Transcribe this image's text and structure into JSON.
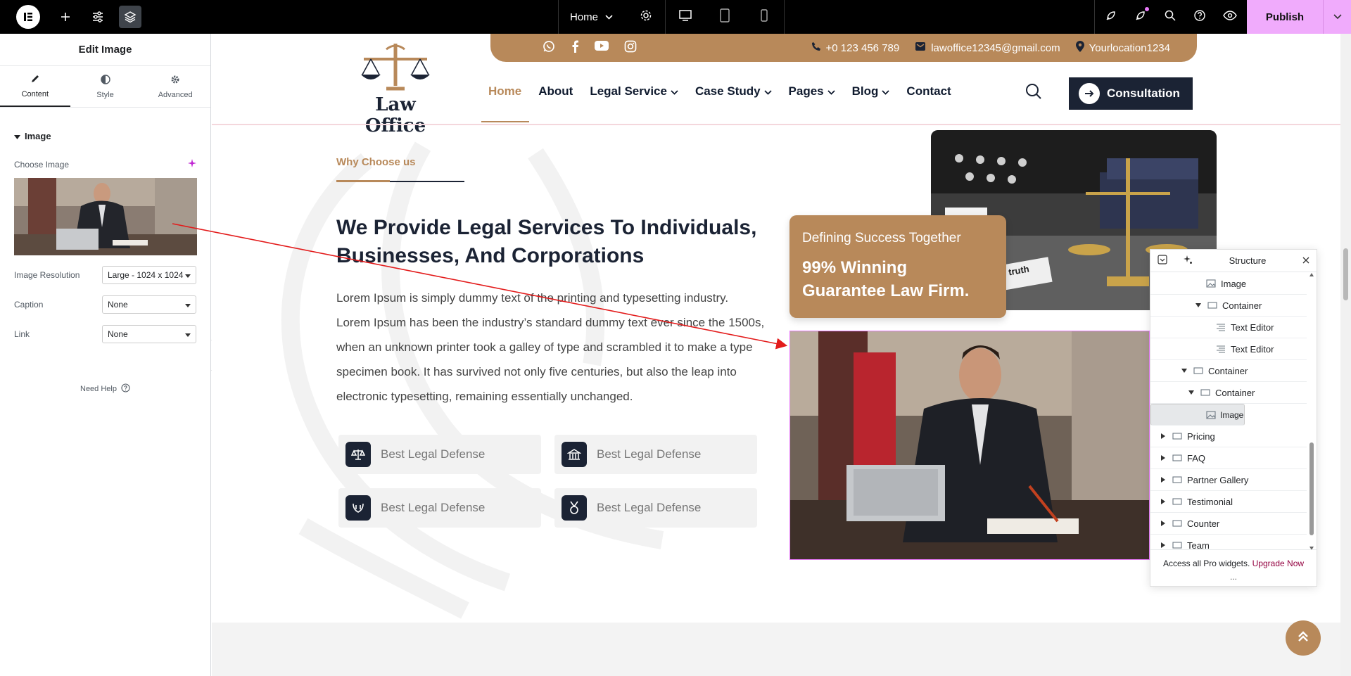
{
  "topbar": {
    "page_name": "Home",
    "publish_label": "Publish"
  },
  "panel": {
    "title": "Edit Image",
    "tabs": [
      {
        "label": "Content"
      },
      {
        "label": "Style"
      },
      {
        "label": "Advanced"
      }
    ],
    "section_title": "Image",
    "choose_image_label": "Choose Image",
    "controls": [
      {
        "label": "Image Resolution",
        "value": "Large - 1024 x 1024"
      },
      {
        "label": "Caption",
        "value": "None"
      },
      {
        "label": "Link",
        "value": "None"
      }
    ],
    "need_help": "Need Help"
  },
  "site": {
    "phone": "+0 123 456 789",
    "email": "lawoffice12345@gmail.com",
    "location": "Yourlocation1234",
    "logo_text": "Law Office",
    "nav": [
      "Home",
      "About",
      "Legal Service",
      "Case Study",
      "Pages",
      "Blog",
      "Contact"
    ],
    "consult_label": "Consultation",
    "eyebrow": "Why Choose us",
    "headline": "We Provide Legal Services To Individuals, Businesses, And Corporations",
    "paragraph": "Lorem Ipsum is simply dummy text of the printing and typesetting industry. Lorem Ipsum has been the industry’s standard dummy text ever since the 1500s, when an unknown printer took a galley of type and scrambled it to make a type specimen book. It has survived not only five centuries, but also the leap into electronic typesetting, remaining essentially unchanged.",
    "features": [
      "Best Legal Defense",
      "Best Legal Defense",
      "Best Legal Defense",
      "Best Legal Defense"
    ],
    "card_sub": "Defining Success Together",
    "card_big": "99% Winning Guarantee Law Firm.",
    "photo_note": "truth"
  },
  "navigator": {
    "title": "Structure",
    "items": [
      {
        "label": "Image",
        "type": "image"
      },
      {
        "label": "Container",
        "type": "container"
      },
      {
        "label": "Text Editor",
        "type": "text"
      },
      {
        "label": "Text Editor",
        "type": "text"
      },
      {
        "label": "Container",
        "type": "container"
      },
      {
        "label": "Container",
        "type": "container"
      },
      {
        "label": "Image",
        "type": "image"
      },
      {
        "label": "Pricing",
        "type": "container"
      },
      {
        "label": "FAQ",
        "type": "container"
      },
      {
        "label": "Partner Gallery",
        "type": "container"
      },
      {
        "label": "Testimonial",
        "type": "container"
      },
      {
        "label": "Counter",
        "type": "container"
      },
      {
        "label": "Team",
        "type": "container"
      }
    ],
    "footer_text": "Access all Pro widgets.",
    "footer_link": "Upgrade Now",
    "footer_dots": "..."
  },
  "colors": {
    "accent": "#b8895a",
    "navy": "#1b2334",
    "publish": "#f0abfc",
    "arrow": "#e31b1b"
  }
}
